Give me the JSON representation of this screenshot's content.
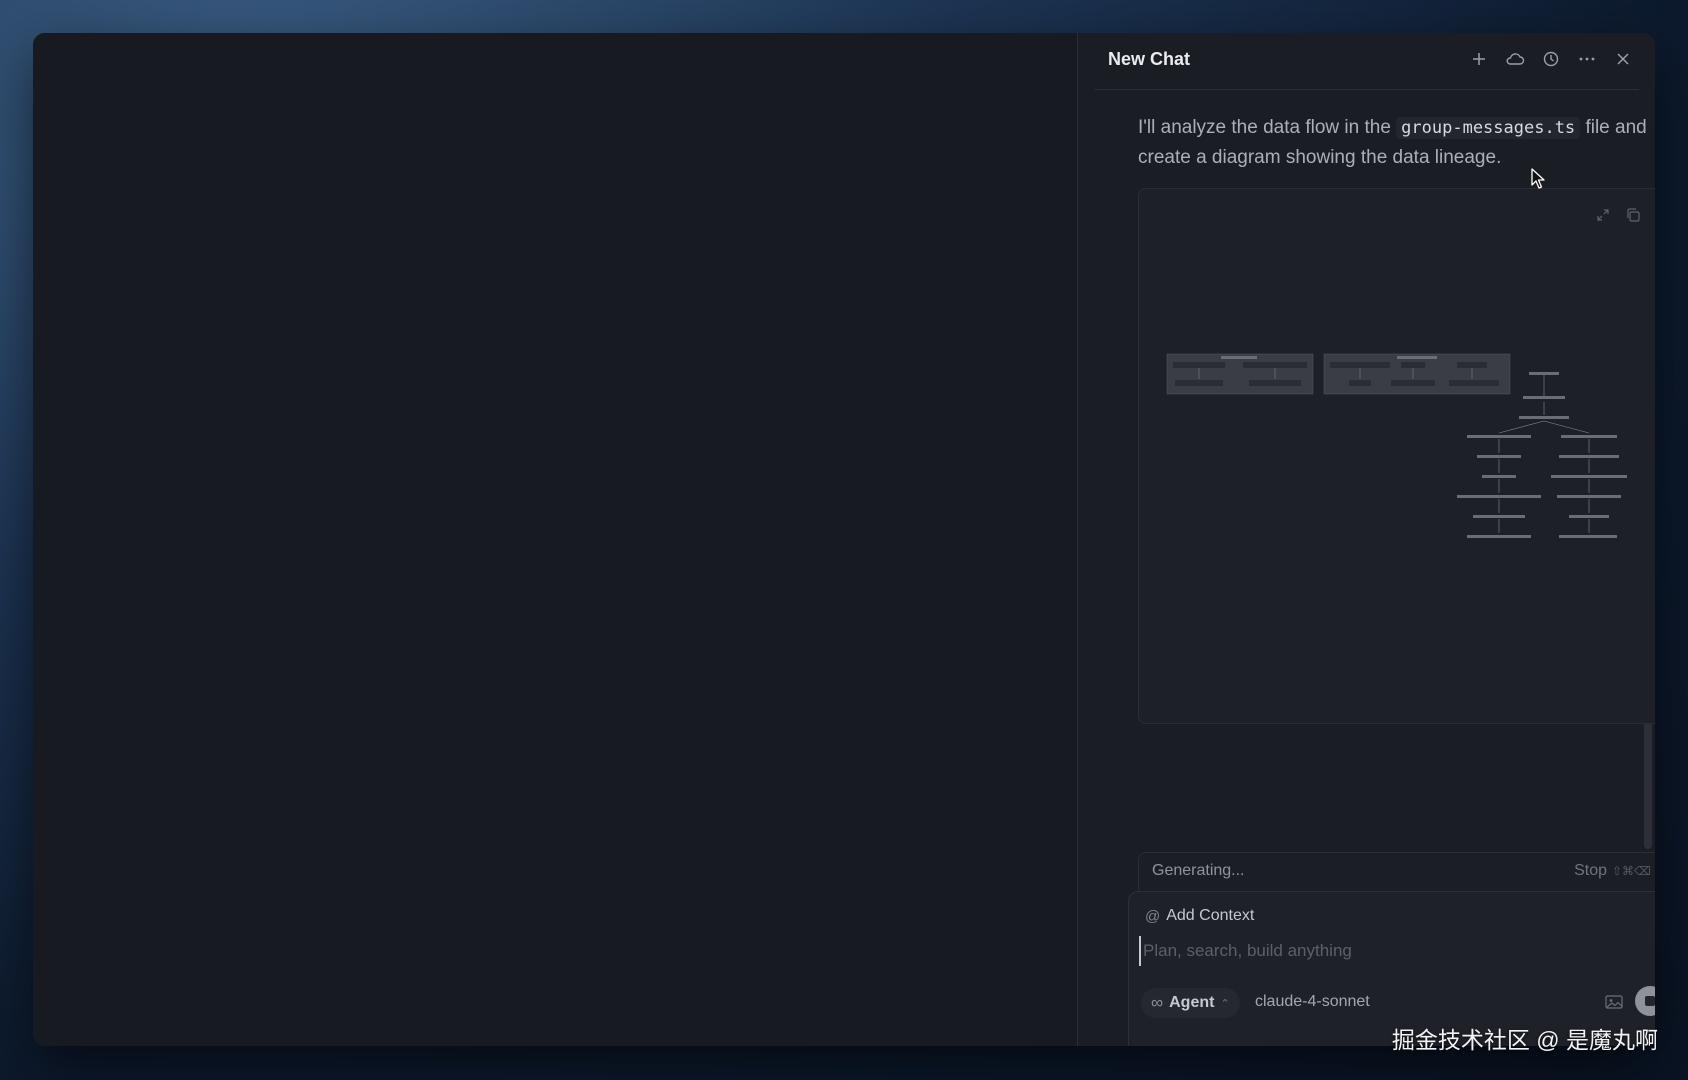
{
  "header": {
    "title": "New Chat",
    "icons": [
      "plus-icon",
      "cloud-icon",
      "history-icon",
      "more-icon",
      "close-icon"
    ]
  },
  "message": {
    "text_before": "I'll analyze the data flow in the ",
    "code": "group-messages.ts",
    "text_after": " file and create a diagram showing the data lineage."
  },
  "diagram_card": {
    "tools": [
      "expand-icon",
      "copy-icon"
    ]
  },
  "status": {
    "generating": "Generating...",
    "stop_label": "Stop",
    "stop_shortcut": "⇧⌘⌫"
  },
  "composer": {
    "add_context": "Add Context",
    "placeholder": "Plan, search, build anything",
    "mode": "Agent",
    "model": "claude-4-sonnet"
  },
  "watermark": "掘金技术社区 @ 是魔丸啊",
  "colors": {
    "window_bg": "#191b22",
    "panel_bg": "#1b1d25",
    "accent_text": "#e9ebef"
  }
}
